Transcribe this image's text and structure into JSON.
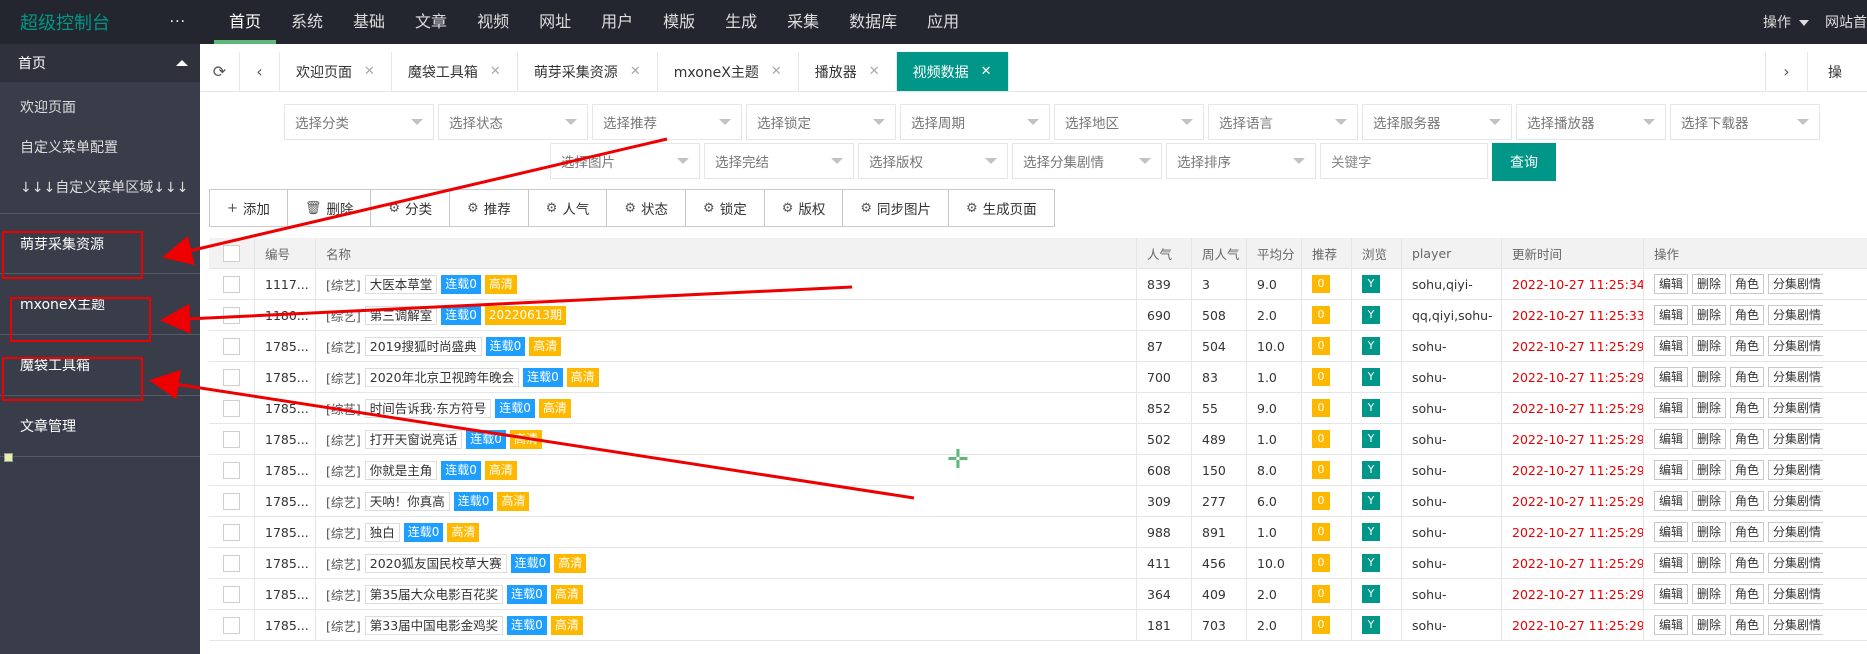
{
  "brand": "超级控制台",
  "brand_more": "···",
  "topnav": [
    "首页",
    "系统",
    "基础",
    "文章",
    "视频",
    "网址",
    "用户",
    "模版",
    "生成",
    "采集",
    "数据库",
    "应用"
  ],
  "topnav_active": 0,
  "topright": {
    "ops_label": "操作",
    "site_label": "网站首"
  },
  "sidebar": {
    "head": "首页",
    "links": [
      "欢迎页面",
      "自定义菜单配置",
      "↓↓↓自定义菜单区域↓↓↓"
    ],
    "groups": [
      "萌芽采集资源",
      "mxoneX主题",
      "魔袋工具箱",
      "文章管理"
    ]
  },
  "tabs": [
    {
      "label": "欢迎页面"
    },
    {
      "label": "魔袋工具箱"
    },
    {
      "label": "萌芽采集资源"
    },
    {
      "label": "mxoneX主题"
    },
    {
      "label": "播放器"
    },
    {
      "label": "视频数据",
      "active": true
    }
  ],
  "tabs_right_label": "操",
  "filters": {
    "row1": [
      "选择分类",
      "选择状态",
      "选择推荐",
      "选择锁定",
      "选择周期",
      "选择地区",
      "选择语言",
      "选择服务器",
      "选择播放器",
      "选择下载器"
    ],
    "row2": [
      "选择图片",
      "选择完结",
      "选择版权",
      "选择分集剧情",
      "选择排序"
    ],
    "keyword_placeholder": "关键字",
    "query_label": "查询"
  },
  "toolbar": [
    {
      "icon": "plus-icon",
      "glyph": "+",
      "label": "添加"
    },
    {
      "icon": "trash-icon",
      "glyph": "🗑",
      "label": "删除"
    },
    {
      "icon": "gear-icon",
      "glyph": "⚙",
      "label": "分类"
    },
    {
      "icon": "gear-icon",
      "glyph": "⚙",
      "label": "推荐"
    },
    {
      "icon": "gear-icon",
      "glyph": "⚙",
      "label": "人气"
    },
    {
      "icon": "gear-icon",
      "glyph": "⚙",
      "label": "状态"
    },
    {
      "icon": "gear-icon",
      "glyph": "⚙",
      "label": "锁定"
    },
    {
      "icon": "gear-icon",
      "glyph": "⚙",
      "label": "版权"
    },
    {
      "icon": "gear-icon",
      "glyph": "⚙",
      "label": "同步图片"
    },
    {
      "icon": "gear-icon",
      "glyph": "⚙",
      "label": "生成页面"
    }
  ],
  "table": {
    "headers": [
      "编号",
      "名称",
      "人气",
      "周人气",
      "平均分",
      "推荐",
      "浏览",
      "player",
      "更新时间",
      "操作"
    ],
    "op_buttons": [
      "编辑",
      "删除",
      "角色",
      "分集剧情"
    ],
    "rows": [
      {
        "id": "1117...",
        "cat": "[综艺]",
        "title": "大医本草堂",
        "b1": "连载0",
        "b2": "高清",
        "pop": "839",
        "week": "3",
        "score": "9.0",
        "rec": "0",
        "browse": "Y",
        "player": "sohu,qiyi-",
        "time": "2022-10-27 11:25:34"
      },
      {
        "id": "1180...",
        "cat": "[综艺]",
        "title": "第三调解室",
        "b1": "连载0",
        "b2": "20220613期",
        "pop": "690",
        "week": "508",
        "score": "2.0",
        "rec": "0",
        "browse": "Y",
        "player": "qq,qiyi,sohu-",
        "time": "2022-10-27 11:25:33"
      },
      {
        "id": "1785...",
        "cat": "[综艺]",
        "title": "2019搜狐时尚盛典",
        "b1": "连载0",
        "b2": "高清",
        "pop": "87",
        "week": "504",
        "score": "10.0",
        "rec": "0",
        "browse": "Y",
        "player": "sohu-",
        "time": "2022-10-27 11:25:29"
      },
      {
        "id": "1785...",
        "cat": "[综艺]",
        "title": "2020年北京卫视跨年晚会",
        "b1": "连载0",
        "b2": "高清",
        "pop": "700",
        "week": "83",
        "score": "1.0",
        "rec": "0",
        "browse": "Y",
        "player": "sohu-",
        "time": "2022-10-27 11:25:29"
      },
      {
        "id": "1785...",
        "cat": "[综艺]",
        "title": "时间告诉我·东方符号",
        "b1": "连载0",
        "b2": "高清",
        "pop": "852",
        "week": "55",
        "score": "9.0",
        "rec": "0",
        "browse": "Y",
        "player": "sohu-",
        "time": "2022-10-27 11:25:29"
      },
      {
        "id": "1785...",
        "cat": "[综艺]",
        "title": "打开天窗说亮话",
        "b1": "连载0",
        "b2": "高清",
        "pop": "502",
        "week": "489",
        "score": "1.0",
        "rec": "0",
        "browse": "Y",
        "player": "sohu-",
        "time": "2022-10-27 11:25:29"
      },
      {
        "id": "1785...",
        "cat": "[综艺]",
        "title": "你就是主角",
        "b1": "连载0",
        "b2": "高清",
        "pop": "608",
        "week": "150",
        "score": "8.0",
        "rec": "0",
        "browse": "Y",
        "player": "sohu-",
        "time": "2022-10-27 11:25:29"
      },
      {
        "id": "1785...",
        "cat": "[综艺]",
        "title": "天呐！你真高",
        "b1": "连载0",
        "b2": "高清",
        "pop": "309",
        "week": "277",
        "score": "6.0",
        "rec": "0",
        "browse": "Y",
        "player": "sohu-",
        "time": "2022-10-27 11:25:29"
      },
      {
        "id": "1785...",
        "cat": "[综艺]",
        "title": "独白",
        "b1": "连载0",
        "b2": "高清",
        "pop": "988",
        "week": "891",
        "score": "1.0",
        "rec": "0",
        "browse": "Y",
        "player": "sohu-",
        "time": "2022-10-27 11:25:29"
      },
      {
        "id": "1785...",
        "cat": "[综艺]",
        "title": "2020狐友国民校草大赛",
        "b1": "连载0",
        "b2": "高清",
        "pop": "411",
        "week": "456",
        "score": "10.0",
        "rec": "0",
        "browse": "Y",
        "player": "sohu-",
        "time": "2022-10-27 11:25:29"
      },
      {
        "id": "1785...",
        "cat": "[综艺]",
        "title": "第35届大众电影百花奖",
        "b1": "连载0",
        "b2": "高清",
        "pop": "364",
        "week": "409",
        "score": "2.0",
        "rec": "0",
        "browse": "Y",
        "player": "sohu-",
        "time": "2022-10-27 11:25:29"
      },
      {
        "id": "1785...",
        "cat": "[综艺]",
        "title": "第33届中国电影金鸡奖",
        "b1": "连载0",
        "b2": "高清",
        "pop": "181",
        "week": "703",
        "score": "2.0",
        "rec": "0",
        "browse": "Y",
        "player": "sohu-",
        "time": "2022-10-27 11:25:29"
      }
    ]
  },
  "colors": {
    "accent": "#009688",
    "topbar": "#23262e",
    "sidebar": "#393d49",
    "annotation": "#e00000"
  }
}
